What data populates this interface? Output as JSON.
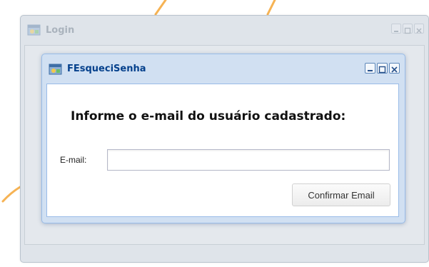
{
  "outer_window": {
    "title": "Login",
    "icon": "app-window-icon",
    "tools": [
      "minimize-icon",
      "maximize-icon",
      "close-icon"
    ]
  },
  "dialog": {
    "title": "FEsqueciSenha",
    "icon": "app-window-icon",
    "tools": [
      "minimize-icon",
      "maximize-icon",
      "close-icon"
    ],
    "heading": "Informe o e-mail do usuário cadastrado:",
    "email_label": "E-mail:",
    "email_value": "",
    "email_placeholder": "",
    "confirm_label": "Confirmar Email"
  },
  "colors": {
    "accent_orange": "#f5a23a",
    "dialog_title": "#04408c",
    "dialog_frame": "#99bce8"
  }
}
